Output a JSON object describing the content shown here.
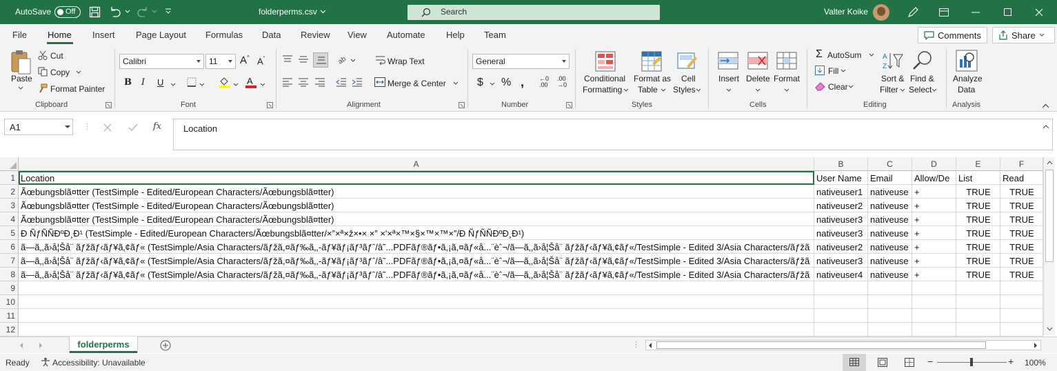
{
  "titlebar": {
    "autosave_label": "AutoSave",
    "autosave_state": "Off",
    "filename": "folderperms.csv",
    "search_placeholder": "Search",
    "user_name": "Valter Koike"
  },
  "menu": {
    "items": [
      "File",
      "Home",
      "Insert",
      "Page Layout",
      "Formulas",
      "Data",
      "Review",
      "View",
      "Automate",
      "Help",
      "Team"
    ],
    "active": "Home",
    "comments_label": "Comments",
    "share_label": "Share"
  },
  "ribbon": {
    "clipboard": {
      "paste": "Paste",
      "cut": "Cut",
      "copy": "Copy",
      "format_painter": "Format Painter",
      "group": "Clipboard"
    },
    "font": {
      "name": "Calibri",
      "size": "11",
      "group": "Font"
    },
    "alignment": {
      "wrap": "Wrap Text",
      "merge": "Merge & Center",
      "group": "Alignment"
    },
    "number": {
      "format": "General",
      "group": "Number"
    },
    "styles": {
      "cond1": "Conditional",
      "cond2": "Formatting",
      "fmt1": "Format as",
      "fmt2": "Table",
      "cell1": "Cell",
      "cell2": "Styles",
      "group": "Styles"
    },
    "cells": {
      "insert": "Insert",
      "delete": "Delete",
      "format": "Format",
      "group": "Cells"
    },
    "editing": {
      "autosum": "AutoSum",
      "fill": "Fill",
      "clear": "Clear",
      "sort1": "Sort &",
      "sort2": "Filter",
      "find1": "Find &",
      "find2": "Select",
      "group": "Editing"
    },
    "analysis": {
      "analyze1": "Analyze",
      "analyze2": "Data",
      "group": "Analysis"
    }
  },
  "formula_bar": {
    "name_box": "A1",
    "content": "Location"
  },
  "grid": {
    "columns": [
      "A",
      "B",
      "C",
      "D",
      "E",
      "F"
    ],
    "row_numbers": [
      "1",
      "2",
      "3",
      "4",
      "5",
      "6",
      "7",
      "8",
      "9",
      "10",
      "11",
      "12"
    ],
    "rows": [
      [
        "Location",
        "User Name",
        "Email",
        "Allow/De",
        "List",
        "Read"
      ],
      [
        "Ãœbungsblã¤tter (TestSimple - Edited/European Characters/Ãœbungsblã¤tter)",
        "nativeuser1",
        "nativeuse",
        "+",
        "TRUE",
        "TRUE"
      ],
      [
        "Ãœbungsblã¤tter (TestSimple - Edited/European Characters/Ãœbungsblã¤tter)",
        "nativeuser2",
        "nativeuse",
        "+",
        "TRUE",
        "TRUE"
      ],
      [
        "Ãœbungsblã¤tter (TestSimple - Edited/European Characters/Ãœbungsblã¤tter)",
        "nativeuser3",
        "nativeuse",
        "+",
        "TRUE",
        "TRUE"
      ],
      [
        "Ð ÑƒÑÑÐºÐ¸Ð¹ (TestSimple - Edited/European Characters/Ãœbungsblã¤tter/×”×ª×ž×•× ×” ×'×ª×™×§×™×™×”/Ð ÑƒÑÑÐºÐ¸Ð¹)",
        "nativeuser3",
        "nativeuse",
        "+",
        "TRUE",
        "TRUE"
      ],
      [
        "ã—ã‚,ã›å¦Šå¨ ãƒžãƒ‹ãƒ¥ã‚¢ãƒ« (TestSimple/Asia Characters/ãƒžã,¤ãƒ‰ã‚,-ãƒ¥ãƒ¡ãƒ³ãƒˆ/â˜...PDFãƒ®ãƒ•ã,¡ã,¤ãƒ«å...¨èˆ¬/ã—ã‚,ã›å¦Šå¨ ãƒžãƒ‹ãƒ¥ã‚¢ãƒ«/TestSimple - Edited 3/Asia Characters/ãƒžã",
        "nativeuser2",
        "nativeuse",
        "+",
        "TRUE",
        "TRUE"
      ],
      [
        "ã—ã‚,ã›å¦Šå¨ ãƒžãƒ‹ãƒ¥ã‚¢ãƒ« (TestSimple/Asia Characters/ãƒžã,¤ãƒ‰ã‚,-ãƒ¥ãƒ¡ãƒ³ãƒˆ/â˜...PDFãƒ®ãƒ•ã,¡ã,¤ãƒ«å...¨èˆ¬/ã—ã‚,ã›å¦Šå¨ ãƒžãƒ‹ãƒ¥ã‚¢ãƒ«/TestSimple - Edited 3/Asia Characters/ãƒžã",
        "nativeuser3",
        "nativeuse",
        "+",
        "TRUE",
        "TRUE"
      ],
      [
        "ã—ã‚,ã›å¦Šå¨ ãƒžãƒ‹ãƒ¥ã‚¢ãƒ« (TestSimple/Asia Characters/ãƒžã,¤ãƒ‰ã‚,-ãƒ¥ãƒ¡ãƒ³ãƒˆ/â˜...PDFãƒ®ãƒ•ã,¡ã,¤ãƒ«å...¨èˆ¬/ã—ã‚,ã›å¦Šå¨ ãƒžãƒ‹ãƒ¥ã‚¢ãƒ«/TestSimple - Edited 3/Asia Characters/ãƒžã",
        "nativeuser4",
        "nativeuse",
        "+",
        "TRUE",
        "TRUE"
      ],
      [
        "",
        "",
        "",
        "",
        "",
        ""
      ],
      [
        "",
        "",
        "",
        "",
        "",
        ""
      ],
      [
        "",
        "",
        "",
        "",
        "",
        ""
      ],
      [
        "",
        "",
        "",
        "",
        "",
        ""
      ]
    ]
  },
  "sheets": {
    "active": "folderperms"
  },
  "status": {
    "ready": "Ready",
    "accessibility": "Accessibility: Unavailable",
    "zoom": "100%"
  },
  "colors": {
    "brand": "#217346"
  }
}
